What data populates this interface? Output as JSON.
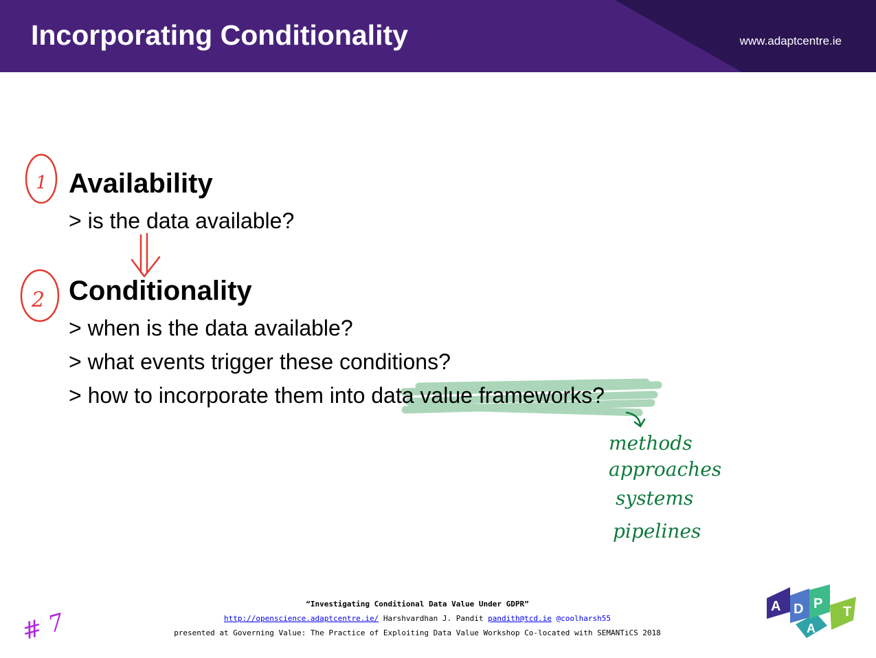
{
  "header": {
    "title": "Incorporating Conditionality",
    "site": "www.adaptcentre.ie",
    "colors": {
      "base": "#48227a",
      "dark": "#2a1552"
    }
  },
  "sections": {
    "availability": {
      "number": "1",
      "title": "Availability",
      "bullets": [
        "> is the data available?"
      ]
    },
    "conditionality": {
      "number": "2",
      "title": "Conditionality",
      "bullets": [
        "> when is the data available?",
        "> what events trigger these conditions?",
        "> how to incorporate them into data value frameworks?"
      ]
    }
  },
  "annotations": {
    "handwritten_list": [
      "methods",
      "approaches",
      "systems",
      "pipelines"
    ],
    "slide_mark": "# 7",
    "ink_colors": {
      "red": "#e03a2f",
      "green": "#0f7a3c",
      "purple": "#b02adf",
      "highlight": "#9ccfae"
    }
  },
  "footer": {
    "talk_title": "“Investigating Conditional Data Value Under GDPR”",
    "link": "http://openscience.adaptcentre.ie/",
    "author": "Harshvardhan J. Pandit",
    "email": "pandith@tcd.ie",
    "handle": "@coolharsh55",
    "venue": "presented at Governing Value: The Practice of Exploiting Data Value Workshop Co-located with SEMANTiCS 2018"
  },
  "logo": {
    "letters": [
      "A",
      "D",
      "A",
      "P",
      "T"
    ],
    "colors": [
      "#3d2c8d",
      "#5078c8",
      "#2fa3a8",
      "#3dbb8a",
      "#8cc63f"
    ]
  }
}
